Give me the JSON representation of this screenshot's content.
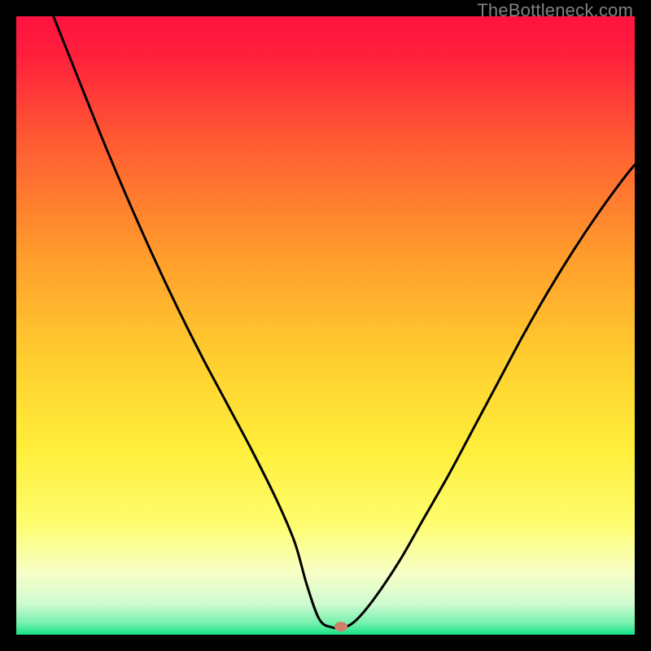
{
  "watermark": "TheBottleneck.com",
  "chart_data": {
    "type": "line",
    "title": "",
    "xlabel": "",
    "ylabel": "",
    "xlim": [
      0,
      100
    ],
    "ylim": [
      0,
      100
    ],
    "background_gradient": {
      "top": "#FF133F",
      "upper_mid": "#FF8A2A",
      "mid": "#FFE733",
      "lower_mid": "#F7FEA4",
      "bottom": "#18E28A"
    },
    "curve": {
      "description": "V-shaped bottleneck curve; steep descent from upper-left, a short near-zero flat segment near x≈47–52, then a shallower rise to the right edge.",
      "x": [
        6,
        10,
        14,
        18,
        22,
        26,
        30,
        34,
        38,
        42,
        45,
        47,
        49,
        51,
        53,
        55,
        58,
        62,
        66,
        70,
        74,
        78,
        82,
        86,
        90,
        94,
        98,
        100
      ],
      "y": [
        100,
        90,
        80,
        70.5,
        61.5,
        53,
        45,
        37.5,
        30,
        22,
        15,
        8,
        2.5,
        1.2,
        1.2,
        2.4,
        6,
        12,
        19,
        26,
        33.5,
        41,
        48.5,
        55.5,
        62,
        68,
        73.5,
        76
      ]
    },
    "marker": {
      "x": 52.5,
      "y": 1.3,
      "color": "#CE8069",
      "shape": "ellipse"
    }
  }
}
